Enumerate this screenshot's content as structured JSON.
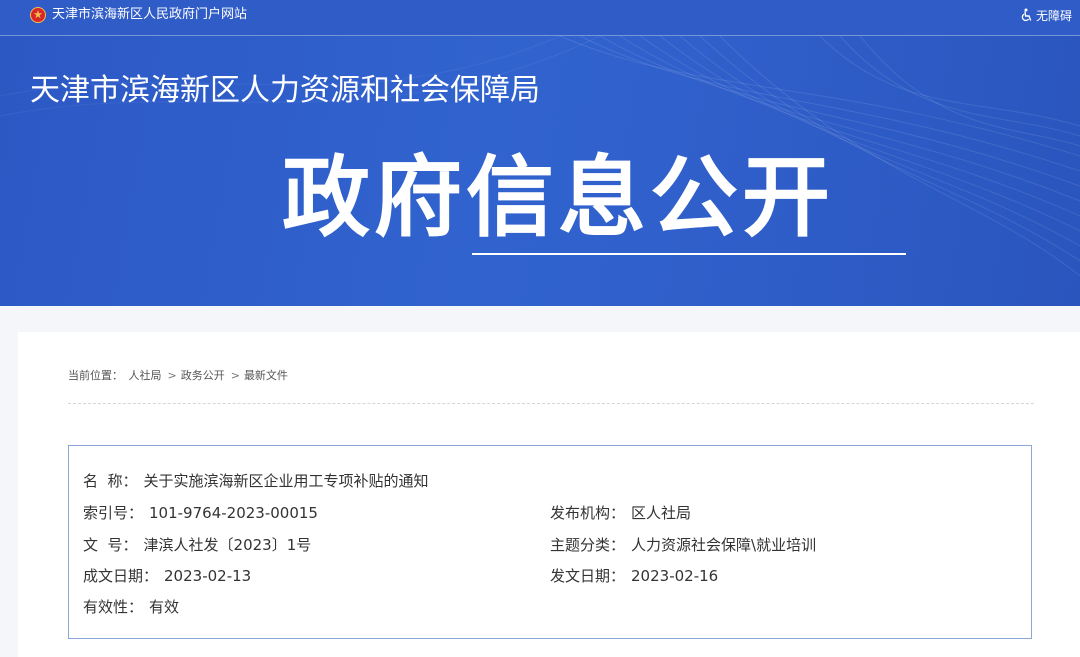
{
  "topbar": {
    "site_name": "天津市滨海新区人民政府门户网站",
    "accessibility_label": "无障碍"
  },
  "banner": {
    "department": "天津市滨海新区人力资源和社会保障局",
    "headline": "政府信息公开"
  },
  "breadcrumb": {
    "label": "当前位置：",
    "items": [
      "人社局",
      "政务公开",
      "最新文件"
    ],
    "separator": ">"
  },
  "document": {
    "name_label": "名  称：",
    "name_value": "关于实施滨海新区企业用工专项补贴的通知",
    "index_label": "索引号：",
    "index_value": "101-9764-2023-00015",
    "issuer_label": "发布机构：",
    "issuer_value": "区人社局",
    "docno_label": "文  号：",
    "docno_value": "津滨人社发〔2023〕1号",
    "topic_label": "主题分类：",
    "topic_value": "人力资源社会保障\\就业培训",
    "written_label": "成文日期：",
    "written_value": "2023-02-13",
    "published_label": "发文日期：",
    "published_value": "2023-02-16",
    "validity_label": "有效性：",
    "validity_value": "有效"
  },
  "colors": {
    "brand_blue": "#2f5cc7",
    "box_border": "#8da6d8"
  }
}
